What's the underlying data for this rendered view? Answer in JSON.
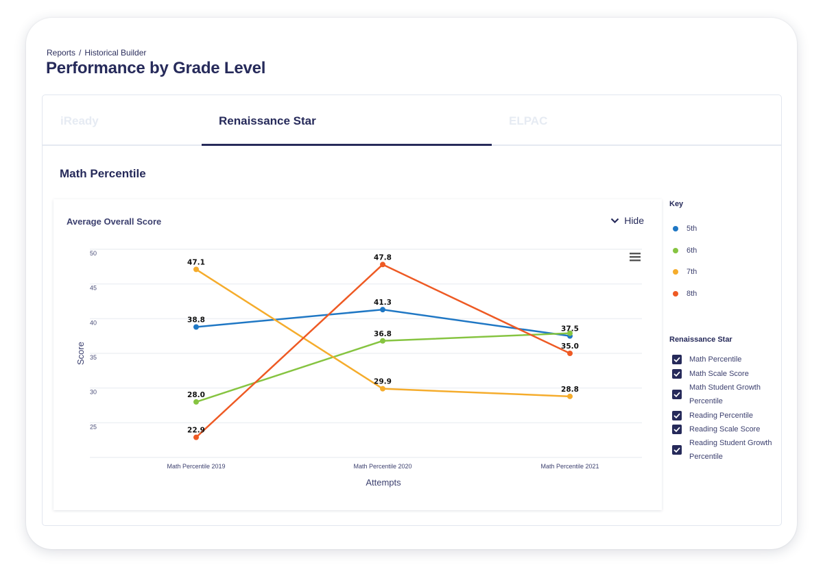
{
  "breadcrumb": {
    "items": [
      "Reports",
      "Historical Builder"
    ],
    "separator": "/"
  },
  "page_title": "Performance by Grade Level",
  "tabs": [
    {
      "label": "iReady",
      "active": false
    },
    {
      "label": "Renaissance Star",
      "active": true
    },
    {
      "label": "ELPAC",
      "active": false
    }
  ],
  "section_title": "Math Percentile",
  "chart_card": {
    "title": "Average Overall Score",
    "hide_label": "Hide"
  },
  "key": {
    "title": "Key",
    "items": [
      {
        "label": "5th",
        "color": "#1f77c4"
      },
      {
        "label": "6th",
        "color": "#86c441"
      },
      {
        "label": "7th",
        "color": "#f5ac2c"
      },
      {
        "label": "8th",
        "color": "#ee5a24"
      }
    ]
  },
  "filters": {
    "title": "Renaissance Star",
    "items": [
      {
        "label": "Math Percentile",
        "checked": true
      },
      {
        "label": "Math Scale Score",
        "checked": true
      },
      {
        "label": "Math Student Growth Percentile",
        "checked": true
      },
      {
        "label": "Reading Percentile",
        "checked": true
      },
      {
        "label": "Reading Scale Score",
        "checked": true
      },
      {
        "label": "Reading Student Growth Percentile",
        "checked": true
      }
    ]
  },
  "chart_data": {
    "type": "line",
    "title": "Average Overall Score",
    "xlabel": "Attempts",
    "ylabel": "Score",
    "categories": [
      "Math Percentile 2019",
      "Math Percentile 2020",
      "Math Percentile 2021"
    ],
    "ylim": [
      20,
      50
    ],
    "yticks": [
      25,
      30,
      35,
      40,
      45,
      50
    ],
    "grid": true,
    "legend": "right",
    "series": [
      {
        "name": "5th",
        "color": "#1f77c4",
        "values": [
          38.8,
          41.3,
          37.5
        ],
        "labels": [
          "38.8",
          "41.3",
          "37.5"
        ]
      },
      {
        "name": "6th",
        "color": "#86c441",
        "values": [
          28.0,
          36.8,
          37.9
        ],
        "labels": [
          "28.0",
          "36.8",
          ""
        ]
      },
      {
        "name": "7th",
        "color": "#f5ac2c",
        "values": [
          47.1,
          29.9,
          28.8
        ],
        "labels": [
          "47.1",
          "29.9",
          "28.8"
        ]
      },
      {
        "name": "8th",
        "color": "#ee5a24",
        "values": [
          22.9,
          47.8,
          35.0
        ],
        "labels": [
          "22.9",
          "47.8",
          "35.0"
        ]
      }
    ]
  }
}
